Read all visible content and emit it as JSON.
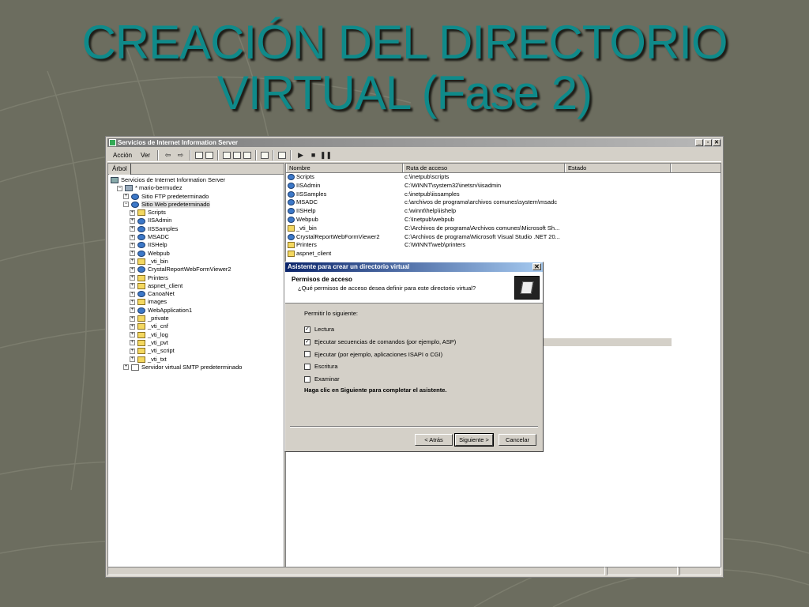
{
  "slide": {
    "title_line1": "CREACIÓN DEL DIRECTORIO",
    "title_line2": "VIRTUAL (Fase 2)"
  },
  "window": {
    "title": "Servicios de Internet Information Server",
    "controls": {
      "minimize": "_",
      "restore": "▫",
      "close": "✕"
    },
    "menu": {
      "action": "Acción",
      "view": "Ver"
    }
  },
  "left_pane": {
    "tab": "Árbol",
    "tree": [
      {
        "level": 0,
        "icon": "comp",
        "label": "Servicios de Internet Information Server",
        "expander": ""
      },
      {
        "level": 1,
        "icon": "server",
        "label": "* mario-bermudez",
        "expander": "−"
      },
      {
        "level": 2,
        "icon": "globe",
        "label": "Sitio FTP predeterminado",
        "expander": "+"
      },
      {
        "level": 2,
        "icon": "globe",
        "label": "Sitio Web predeterminado",
        "expander": "−",
        "selected": true
      },
      {
        "level": 3,
        "icon": "folder",
        "label": "Scripts",
        "expander": "+"
      },
      {
        "level": 3,
        "icon": "globe",
        "label": "IISAdmin",
        "expander": "+"
      },
      {
        "level": 3,
        "icon": "globe",
        "label": "IISSamples",
        "expander": "+"
      },
      {
        "level": 3,
        "icon": "globe",
        "label": "MSADC",
        "expander": "+"
      },
      {
        "level": 3,
        "icon": "globe",
        "label": "IISHelp",
        "expander": "+"
      },
      {
        "level": 3,
        "icon": "globe",
        "label": "Webpub",
        "expander": "+"
      },
      {
        "level": 3,
        "icon": "folder",
        "label": "_vti_bin",
        "expander": "+"
      },
      {
        "level": 3,
        "icon": "globe",
        "label": "CrystalReportWebFormViewer2",
        "expander": "+"
      },
      {
        "level": 3,
        "icon": "folder",
        "label": "Printers",
        "expander": "+"
      },
      {
        "level": 3,
        "icon": "folder",
        "label": "aspnet_client",
        "expander": "+"
      },
      {
        "level": 3,
        "icon": "globe",
        "label": "CanoaNet",
        "expander": "+"
      },
      {
        "level": 3,
        "icon": "folder",
        "label": "images",
        "expander": "+"
      },
      {
        "level": 3,
        "icon": "globe",
        "label": "WebApplication1",
        "expander": "+"
      },
      {
        "level": 3,
        "icon": "folder",
        "label": "_private",
        "expander": "+"
      },
      {
        "level": 3,
        "icon": "folder",
        "label": "_vti_cnf",
        "expander": "+"
      },
      {
        "level": 3,
        "icon": "folder",
        "label": "_vti_log",
        "expander": "+"
      },
      {
        "level": 3,
        "icon": "folder",
        "label": "_vti_pvt",
        "expander": "+"
      },
      {
        "level": 3,
        "icon": "folder",
        "label": "_vti_script",
        "expander": "+"
      },
      {
        "level": 3,
        "icon": "folder",
        "label": "_vti_txt",
        "expander": "+"
      },
      {
        "level": 2,
        "icon": "mail",
        "label": "Servidor virtual SMTP predeterminado",
        "expander": "+"
      }
    ]
  },
  "right_pane": {
    "columns": [
      "Nombre",
      "Ruta de acceso",
      "Estado"
    ],
    "rows": [
      {
        "icon": "globe",
        "name": "Scripts",
        "path": "c:\\inetpub\\scripts"
      },
      {
        "icon": "globe",
        "name": "IISAdmin",
        "path": "C:\\WINNT\\system32\\inetsrv\\iisadmin"
      },
      {
        "icon": "globe",
        "name": "IISSamples",
        "path": "c:\\inetpub\\iissamples"
      },
      {
        "icon": "globe",
        "name": "MSADC",
        "path": "c:\\archivos de programa\\archivos comunes\\system\\msadc"
      },
      {
        "icon": "globe",
        "name": "IISHelp",
        "path": "c:\\winnt\\help\\iishelp"
      },
      {
        "icon": "globe",
        "name": "Webpub",
        "path": "C:\\Inetpub\\webpub"
      },
      {
        "icon": "folder",
        "name": "_vti_bin",
        "path": "C:\\Archivos de programa\\Archivos comunes\\Microsoft Sh..."
      },
      {
        "icon": "globe",
        "name": "CrystalReportWebFormViewer2",
        "path": "C:\\Archivos de programa\\Microsoft Visual Studio .NET 20..."
      },
      {
        "icon": "folder",
        "name": "Printers",
        "path": "C:\\WINNT\\web\\printers"
      },
      {
        "icon": "folder",
        "name": "aspnet_client",
        "path": ""
      }
    ]
  },
  "dialog": {
    "title": "Asistente para crear un directorio virtual",
    "close": "✕",
    "header_title": "Permisos de acceso",
    "header_subtitle": "¿Qué permisos de acceso desea definir para este directorio virtual?",
    "permit_label": "Permitir lo siguiente:",
    "options": [
      {
        "label": "Lectura",
        "checked": true
      },
      {
        "label": "Ejecutar secuencias de comandos (por ejemplo, ASP)",
        "checked": true
      },
      {
        "label": "Ejecutar (por ejemplo, aplicaciones ISAPI o CGI)",
        "checked": false
      },
      {
        "label": "Escritura",
        "checked": false
      },
      {
        "label": "Examinar",
        "checked": false
      }
    ],
    "hint": "Haga clic en Siguiente para completar el asistente.",
    "buttons": {
      "back": "< Atrás",
      "next": "Siguiente >",
      "cancel": "Cancelar"
    }
  }
}
